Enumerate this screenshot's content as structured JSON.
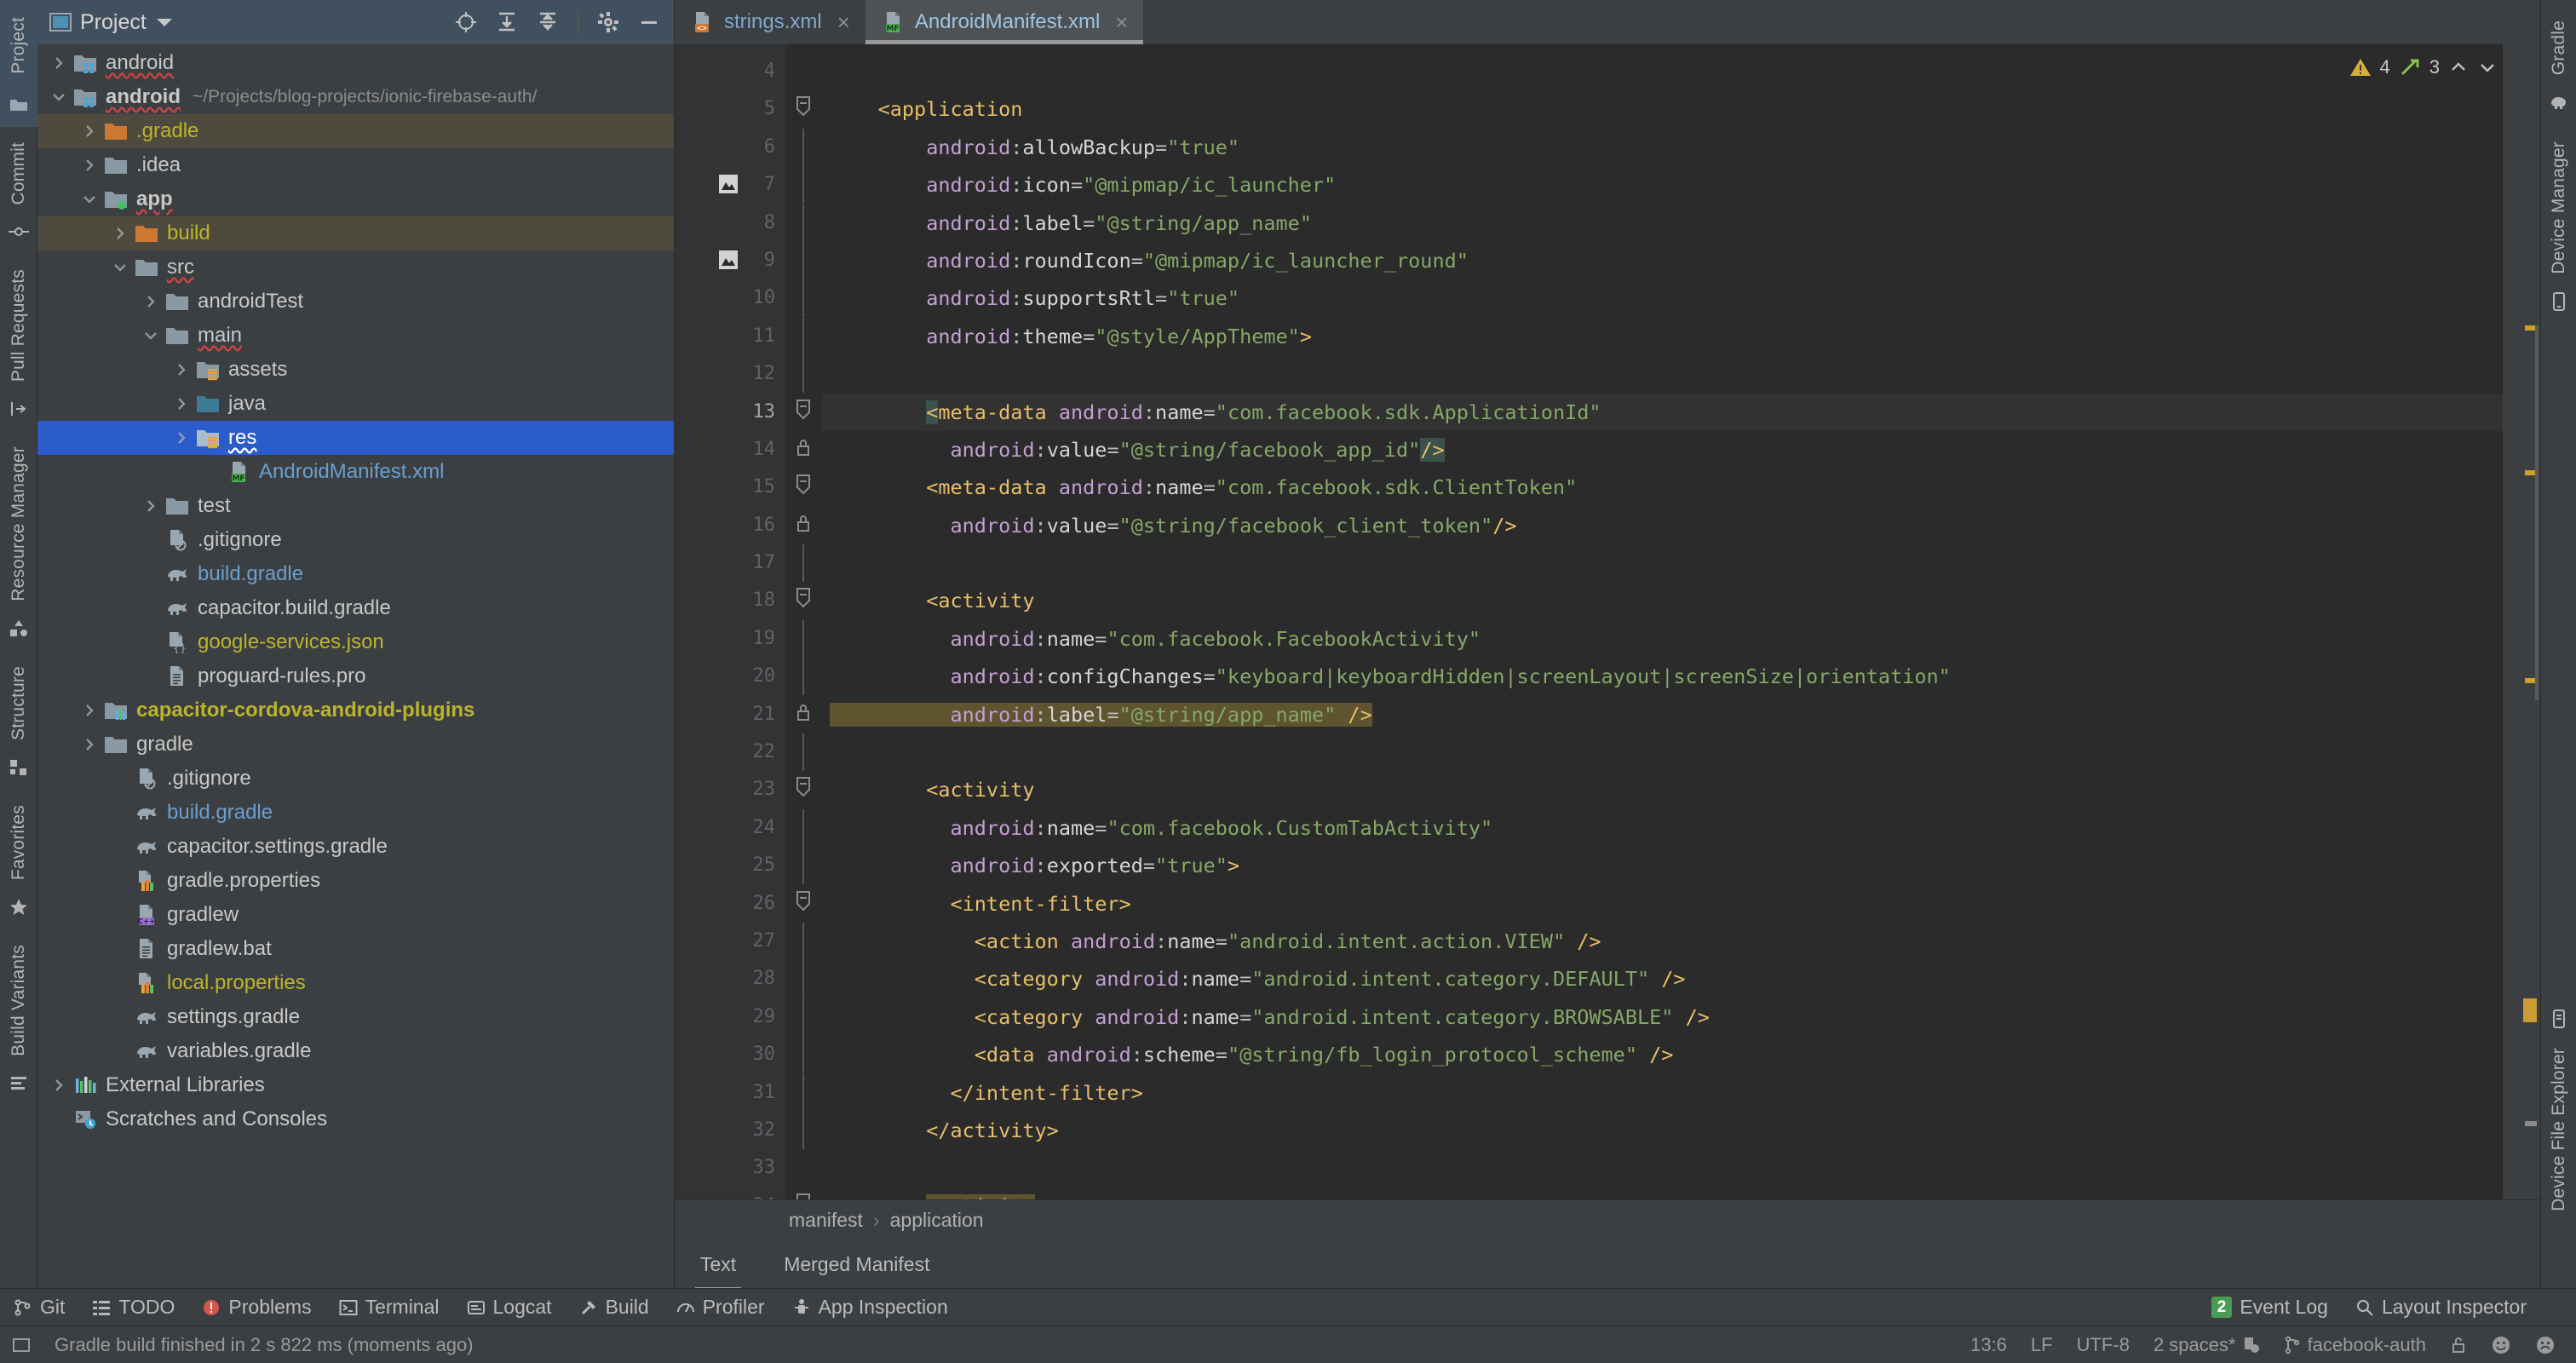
{
  "left_rail": {
    "items": [
      {
        "label": "Project",
        "icon": "project-icon"
      },
      {
        "label": "Commit",
        "icon": "commit-icon"
      },
      {
        "label": "Pull Requests",
        "icon": "pull-requests-icon"
      },
      {
        "label": "Resource Manager",
        "icon": "resource-manager-icon"
      },
      {
        "label": "Structure",
        "icon": "structure-icon"
      },
      {
        "label": "Favorites",
        "icon": "favorites-star-icon"
      },
      {
        "label": "Build Variants",
        "icon": "build-variants-icon"
      }
    ]
  },
  "right_rail": {
    "items": [
      {
        "label": "Gradle",
        "icon": "gradle-elephant-icon"
      },
      {
        "label": "Device Manager",
        "icon": "device-manager-icon"
      },
      {
        "label": "Device File Explorer",
        "icon": "device-file-explorer-icon"
      }
    ]
  },
  "project_panel": {
    "title": "Project",
    "title_dropdown": "chevron-down-icon",
    "header_icons": [
      "locate-icon",
      "expand-all-icon",
      "collapse-all-icon",
      "settings-gear-icon",
      "hide-minus-icon"
    ],
    "tree": [
      {
        "label": "android",
        "sub": "",
        "indent": 0,
        "arrow": "collapsed",
        "icon": "android-module-folder",
        "color": "grey",
        "bold": false,
        "wavy": true,
        "state": "normal"
      },
      {
        "label": "android",
        "sub": "~/Projects/blog-projects/ionic-firebase-auth/",
        "indent": 0,
        "arrow": "expanded",
        "icon": "android-module-folder",
        "color": "grey",
        "bold": true,
        "wavy": true,
        "state": "normal"
      },
      {
        "label": ".gradle",
        "sub": "",
        "indent": 1,
        "arrow": "collapsed",
        "icon": "orange-folder",
        "color": "yellow",
        "bold": false,
        "wavy": false,
        "state": "brown"
      },
      {
        "label": ".idea",
        "sub": "",
        "indent": 1,
        "arrow": "collapsed",
        "icon": "grey-folder",
        "color": "grey",
        "bold": false,
        "wavy": false,
        "state": "normal"
      },
      {
        "label": "app",
        "sub": "",
        "indent": 1,
        "arrow": "expanded",
        "icon": "module-folder-green",
        "color": "grey",
        "bold": true,
        "wavy": true,
        "state": "normal"
      },
      {
        "label": "build",
        "sub": "",
        "indent": 2,
        "arrow": "collapsed",
        "icon": "orange-folder",
        "color": "yellow",
        "bold": false,
        "wavy": false,
        "state": "brown"
      },
      {
        "label": "src",
        "sub": "",
        "indent": 2,
        "arrow": "expanded",
        "icon": "grey-folder",
        "color": "grey",
        "bold": false,
        "wavy": true,
        "state": "normal"
      },
      {
        "label": "androidTest",
        "sub": "",
        "indent": 3,
        "arrow": "collapsed",
        "icon": "grey-folder",
        "color": "grey",
        "bold": false,
        "wavy": false,
        "state": "normal"
      },
      {
        "label": "main",
        "sub": "",
        "indent": 3,
        "arrow": "expanded",
        "icon": "grey-folder",
        "color": "grey",
        "bold": false,
        "wavy": true,
        "state": "normal"
      },
      {
        "label": "assets",
        "sub": "",
        "indent": 4,
        "arrow": "collapsed",
        "icon": "assets-folder",
        "color": "grey",
        "bold": false,
        "wavy": false,
        "state": "normal"
      },
      {
        "label": "java",
        "sub": "",
        "indent": 4,
        "arrow": "collapsed",
        "icon": "java-folder",
        "color": "grey",
        "bold": false,
        "wavy": false,
        "state": "normal"
      },
      {
        "label": "res",
        "sub": "",
        "indent": 4,
        "arrow": "collapsed",
        "icon": "res-folder",
        "color": "grey",
        "bold": false,
        "wavy": true,
        "state": "selected"
      },
      {
        "label": "AndroidManifest.xml",
        "sub": "",
        "indent": 5,
        "arrow": "none",
        "icon": "manifest-file-icon",
        "color": "blue",
        "bold": false,
        "wavy": false,
        "state": "normal"
      },
      {
        "label": "test",
        "sub": "",
        "indent": 3,
        "arrow": "collapsed",
        "icon": "grey-folder",
        "color": "grey",
        "bold": false,
        "wavy": false,
        "state": "normal"
      },
      {
        "label": ".gitignore",
        "sub": "",
        "indent": 3,
        "arrow": "none",
        "icon": "gitignore-file-icon",
        "color": "grey",
        "bold": false,
        "wavy": false,
        "state": "normal"
      },
      {
        "label": "build.gradle",
        "sub": "",
        "indent": 3,
        "arrow": "none",
        "icon": "gradle-file-icon",
        "color": "blue",
        "bold": false,
        "wavy": false,
        "state": "normal"
      },
      {
        "label": "capacitor.build.gradle",
        "sub": "",
        "indent": 3,
        "arrow": "none",
        "icon": "gradle-file-icon",
        "color": "grey",
        "bold": false,
        "wavy": false,
        "state": "normal"
      },
      {
        "label": "google-services.json",
        "sub": "",
        "indent": 3,
        "arrow": "none",
        "icon": "json-file-icon",
        "color": "yellow",
        "bold": false,
        "wavy": false,
        "state": "normal"
      },
      {
        "label": "proguard-rules.pro",
        "sub": "",
        "indent": 3,
        "arrow": "none",
        "icon": "text-file-icon",
        "color": "grey",
        "bold": false,
        "wavy": false,
        "state": "normal"
      },
      {
        "label": "capacitor-cordova-android-plugins",
        "sub": "",
        "indent": 1,
        "arrow": "collapsed",
        "icon": "module-folder-chart",
        "color": "yellow",
        "bold": true,
        "wavy": false,
        "state": "normal"
      },
      {
        "label": "gradle",
        "sub": "",
        "indent": 1,
        "arrow": "collapsed",
        "icon": "grey-folder",
        "color": "grey",
        "bold": false,
        "wavy": false,
        "state": "normal"
      },
      {
        "label": ".gitignore",
        "sub": "",
        "indent": 2,
        "arrow": "none",
        "icon": "gitignore-file-icon",
        "color": "grey",
        "bold": false,
        "wavy": false,
        "state": "normal"
      },
      {
        "label": "build.gradle",
        "sub": "",
        "indent": 2,
        "arrow": "none",
        "icon": "gradle-file-icon",
        "color": "blue",
        "bold": false,
        "wavy": false,
        "state": "normal"
      },
      {
        "label": "capacitor.settings.gradle",
        "sub": "",
        "indent": 2,
        "arrow": "none",
        "icon": "gradle-file-icon",
        "color": "grey",
        "bold": false,
        "wavy": false,
        "state": "normal"
      },
      {
        "label": "gradle.properties",
        "sub": "",
        "indent": 2,
        "arrow": "none",
        "icon": "properties-file-icon",
        "color": "grey",
        "bold": false,
        "wavy": false,
        "state": "normal"
      },
      {
        "label": "gradlew",
        "sub": "",
        "indent": 2,
        "arrow": "none",
        "icon": "cpp-file-icon",
        "color": "grey",
        "bold": false,
        "wavy": false,
        "state": "normal"
      },
      {
        "label": "gradlew.bat",
        "sub": "",
        "indent": 2,
        "arrow": "none",
        "icon": "text-file-icon",
        "color": "grey",
        "bold": false,
        "wavy": false,
        "state": "normal"
      },
      {
        "label": "local.properties",
        "sub": "",
        "indent": 2,
        "arrow": "none",
        "icon": "properties-file-icon",
        "color": "yellow",
        "bold": false,
        "wavy": false,
        "state": "normal"
      },
      {
        "label": "settings.gradle",
        "sub": "",
        "indent": 2,
        "arrow": "none",
        "icon": "gradle-file-icon",
        "color": "grey",
        "bold": false,
        "wavy": false,
        "state": "normal"
      },
      {
        "label": "variables.gradle",
        "sub": "",
        "indent": 2,
        "arrow": "none",
        "icon": "gradle-file-icon",
        "color": "grey",
        "bold": false,
        "wavy": false,
        "state": "normal"
      },
      {
        "label": "External Libraries",
        "sub": "",
        "indent": 0,
        "arrow": "collapsed",
        "icon": "libraries-icon",
        "color": "grey",
        "bold": false,
        "wavy": false,
        "state": "normal"
      },
      {
        "label": "Scratches and Consoles",
        "sub": "",
        "indent": 0,
        "arrow": "none",
        "icon": "scratches-icon",
        "color": "grey",
        "bold": false,
        "wavy": false,
        "state": "normal"
      }
    ]
  },
  "editor": {
    "tabs": [
      {
        "label": "strings.xml",
        "icon": "xml-file-icon",
        "active": false,
        "close": "×"
      },
      {
        "label": "AndroidManifest.xml",
        "icon": "manifest-file-icon",
        "active": true,
        "close": "×"
      }
    ],
    "inspections": {
      "warning_count": "4",
      "weak_count": "3",
      "warning_icon": "warning-triangle-icon",
      "weak_icon": "weak-warning-icon",
      "up_icon": "chevron-up-icon",
      "down_icon": "chevron-down-icon"
    },
    "first_line_number": 4,
    "current_line": 13,
    "lines": [
      {
        "n": 4,
        "text": "",
        "fold": "none",
        "pic": false
      },
      {
        "n": 5,
        "text": "    <application",
        "fold": "minus",
        "pic": false
      },
      {
        "n": 6,
        "text": "        android:allowBackup=\"true\"",
        "fold": "bar",
        "pic": false
      },
      {
        "n": 7,
        "text": "        android:icon=\"@mipmap/ic_launcher\"",
        "fold": "bar",
        "pic": true
      },
      {
        "n": 8,
        "text": "        android:label=\"@string/app_name\"",
        "fold": "bar",
        "pic": false
      },
      {
        "n": 9,
        "text": "        android:roundIcon=\"@mipmap/ic_launcher_round\"",
        "fold": "bar",
        "pic": true
      },
      {
        "n": 10,
        "text": "        android:supportsRtl=\"true\"",
        "fold": "bar",
        "pic": false
      },
      {
        "n": 11,
        "text": "        android:theme=\"@style/AppTheme\">",
        "fold": "bar",
        "pic": false
      },
      {
        "n": 12,
        "text": "",
        "fold": "bar",
        "pic": false
      },
      {
        "n": 13,
        "text": "        <meta-data android:name=\"com.facebook.sdk.ApplicationId\"",
        "fold": "minus",
        "pic": false
      },
      {
        "n": 14,
        "text": "          android:value=\"@string/facebook_app_id\"/>",
        "fold": "lock",
        "pic": false
      },
      {
        "n": 15,
        "text": "        <meta-data android:name=\"com.facebook.sdk.ClientToken\"",
        "fold": "minus",
        "pic": false
      },
      {
        "n": 16,
        "text": "          android:value=\"@string/facebook_client_token\"/>",
        "fold": "lock",
        "pic": false
      },
      {
        "n": 17,
        "text": "",
        "fold": "bar",
        "pic": false
      },
      {
        "n": 18,
        "text": "        <activity",
        "fold": "minus",
        "pic": false
      },
      {
        "n": 19,
        "text": "          android:name=\"com.facebook.FacebookActivity\"",
        "fold": "bar",
        "pic": false
      },
      {
        "n": 20,
        "text": "          android:configChanges=\"keyboard|keyboardHidden|screenLayout|screenSize|orientation\"",
        "fold": "bar",
        "pic": false
      },
      {
        "n": 21,
        "text": "          android:label=\"@string/app_name\" />",
        "fold": "lock",
        "pic": false
      },
      {
        "n": 22,
        "text": "",
        "fold": "bar",
        "pic": false
      },
      {
        "n": 23,
        "text": "        <activity",
        "fold": "minus",
        "pic": false
      },
      {
        "n": 24,
        "text": "          android:name=\"com.facebook.CustomTabActivity\"",
        "fold": "bar",
        "pic": false
      },
      {
        "n": 25,
        "text": "          android:exported=\"true\">",
        "fold": "bar",
        "pic": false
      },
      {
        "n": 26,
        "text": "          <intent-filter>",
        "fold": "minus",
        "pic": false
      },
      {
        "n": 27,
        "text": "            <action android:name=\"android.intent.action.VIEW\" />",
        "fold": "bar",
        "pic": false
      },
      {
        "n": 28,
        "text": "            <category android:name=\"android.intent.category.DEFAULT\" />",
        "fold": "bar",
        "pic": false
      },
      {
        "n": 29,
        "text": "            <category android:name=\"android.intent.category.BROWSABLE\" />",
        "fold": "bar",
        "pic": false
      },
      {
        "n": 30,
        "text": "            <data android:scheme=\"@string/fb_login_protocol_scheme\" />",
        "fold": "bar",
        "pic": false
      },
      {
        "n": 31,
        "text": "          </intent-filter>",
        "fold": "bar",
        "pic": false
      },
      {
        "n": 32,
        "text": "        </activity>",
        "fold": "bar",
        "pic": false
      },
      {
        "n": 33,
        "text": "",
        "fold": "none",
        "pic": false
      },
      {
        "n": 34,
        "text": "        <activity",
        "fold": "minus",
        "pic": false
      }
    ],
    "breadcrumb": [
      "manifest",
      "application"
    ],
    "breadcrumb_sep": "›",
    "bottom_tabs": [
      {
        "label": "Text",
        "active": true
      },
      {
        "label": "Merged Manifest",
        "active": false
      }
    ]
  },
  "toolwindow_bar": {
    "left_items": [
      {
        "label": "Git",
        "icon": "git-branch-icon"
      },
      {
        "label": "TODO",
        "icon": "todo-list-icon"
      },
      {
        "label": "Problems",
        "icon": "problems-error-icon"
      },
      {
        "label": "Terminal",
        "icon": "terminal-icon"
      },
      {
        "label": "Logcat",
        "icon": "logcat-icon"
      },
      {
        "label": "Build",
        "icon": "build-hammer-icon"
      },
      {
        "label": "Profiler",
        "icon": "profiler-icon"
      },
      {
        "label": "App Inspection",
        "icon": "app-inspection-icon"
      }
    ],
    "right_items": [
      {
        "label": "Event Log",
        "icon": "event-log-badge",
        "badge": "2"
      },
      {
        "label": "Layout Inspector",
        "icon": "layout-inspector-icon",
        "badge": ""
      }
    ]
  },
  "statusbar": {
    "left_icon": "todo-square-icon",
    "message": "Gradle build finished in 2 s 822 ms (moments ago)",
    "caret": "13:6",
    "line_sep": "LF",
    "encoding": "UTF-8",
    "indent": "2 spaces*",
    "indent_icon": "indent-config-icon",
    "branch": "facebook-auth",
    "branch_icon": "git-branch-icon",
    "lock_icon": "unlocked-icon",
    "happy_icon": "smiley-happy-icon",
    "sad_icon": "smiley-sad-icon"
  },
  "colors": {
    "accent_selection": "#2a5ccb",
    "panel_bg": "#3c3f41",
    "editor_bg": "#2b2b2b",
    "tab_header_bg": "#41505e",
    "folder_orange": "#cc7832",
    "yellow_text": "#bbb529",
    "blue_text": "#6a9ece",
    "green_badge": "#499c54",
    "tag_color": "#e8bf6a",
    "attr_color": "#c49fd3",
    "string_color": "#85a868"
  }
}
